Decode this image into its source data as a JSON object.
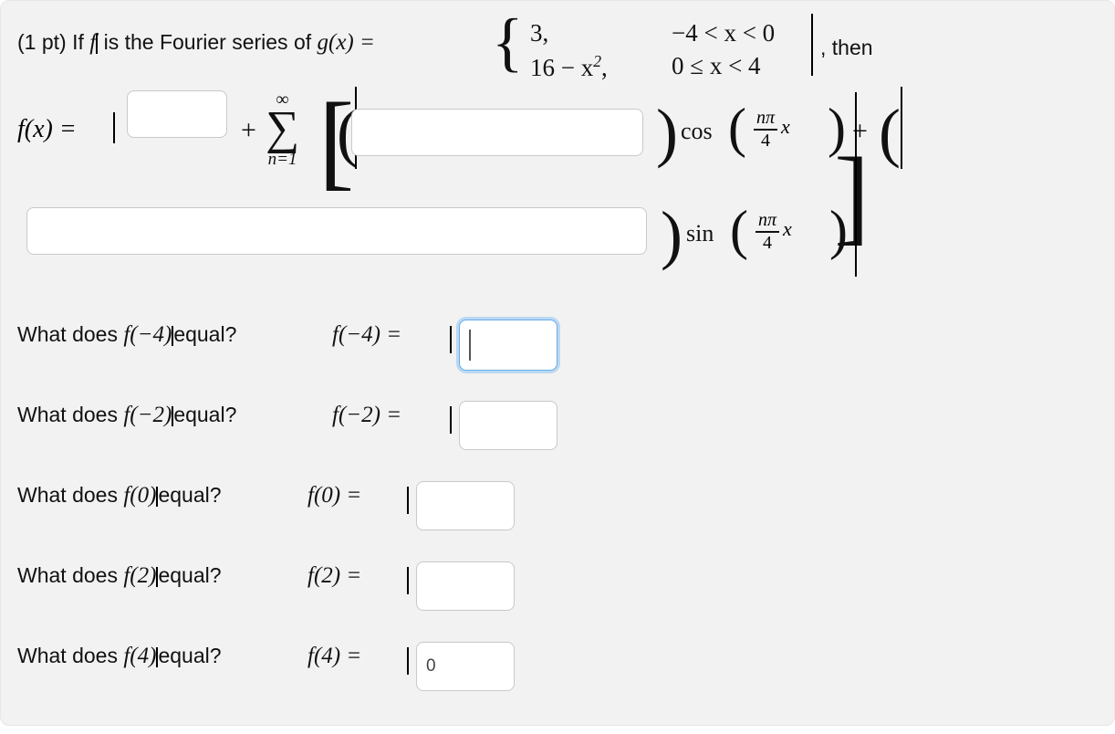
{
  "problem": {
    "points_label": "(1 pt)",
    "intro_before_f": "If",
    "f_symbol": "f",
    "intro_after_f": "is the Fourier series of",
    "g_label": "g(x) =",
    "then_label": ", then",
    "piecewise": [
      {
        "expression": "3,",
        "domain": "−4 < x < 0"
      },
      {
        "expression": "16 − x",
        "exponent": "2",
        "expression_tail": ",",
        "domain": "0 ≤ x < 4"
      }
    ]
  },
  "series": {
    "lhs": "f(x) =",
    "plus": "+",
    "sigma": {
      "top": "∞",
      "symbol": "∑",
      "bottom": "n=1"
    },
    "open_bracket": "[",
    "open_paren": "(",
    "close_paren": ")",
    "close_bracket": "]",
    "cos_label": "cos",
    "sin_label": "sin",
    "fraction": {
      "numerator": "nπ",
      "denominator": "4"
    },
    "variable": "x",
    "plus2": "+",
    "a0_input": {
      "value": "",
      "placeholder": ""
    },
    "an_input": {
      "value": "",
      "placeholder": ""
    },
    "bn_input": {
      "value": "",
      "placeholder": ""
    }
  },
  "questions": [
    {
      "prompt": "What does",
      "arg": "f(−4)",
      "prompt_tail": "equal?",
      "eval_label": "f(−4) =",
      "input": {
        "value": "",
        "focused": true
      }
    },
    {
      "prompt": "What does",
      "arg": "f(−2)",
      "prompt_tail": "equal?",
      "eval_label": "f(−2) =",
      "input": {
        "value": "",
        "focused": false
      }
    },
    {
      "prompt": "What does",
      "arg": "f(0)",
      "prompt_tail": "equal?",
      "eval_label": "f(0) =",
      "input": {
        "value": "",
        "focused": false
      }
    },
    {
      "prompt": "What does",
      "arg": "f(2)",
      "prompt_tail": "equal?",
      "eval_label": "f(2) =",
      "input": {
        "value": "",
        "focused": false
      }
    },
    {
      "prompt": "What does",
      "arg": "f(4)",
      "prompt_tail": "equal?",
      "eval_label": "f(4) =",
      "input": {
        "value": "0",
        "focused": false
      }
    }
  ],
  "colors": {
    "panel_background": "#f2f2f2",
    "page_background": "#ffffff",
    "text": "#111111",
    "input_border": "#c9c9c9",
    "input_background": "#ffffff",
    "focus_border": "#63aeee",
    "caret": "#555555"
  }
}
